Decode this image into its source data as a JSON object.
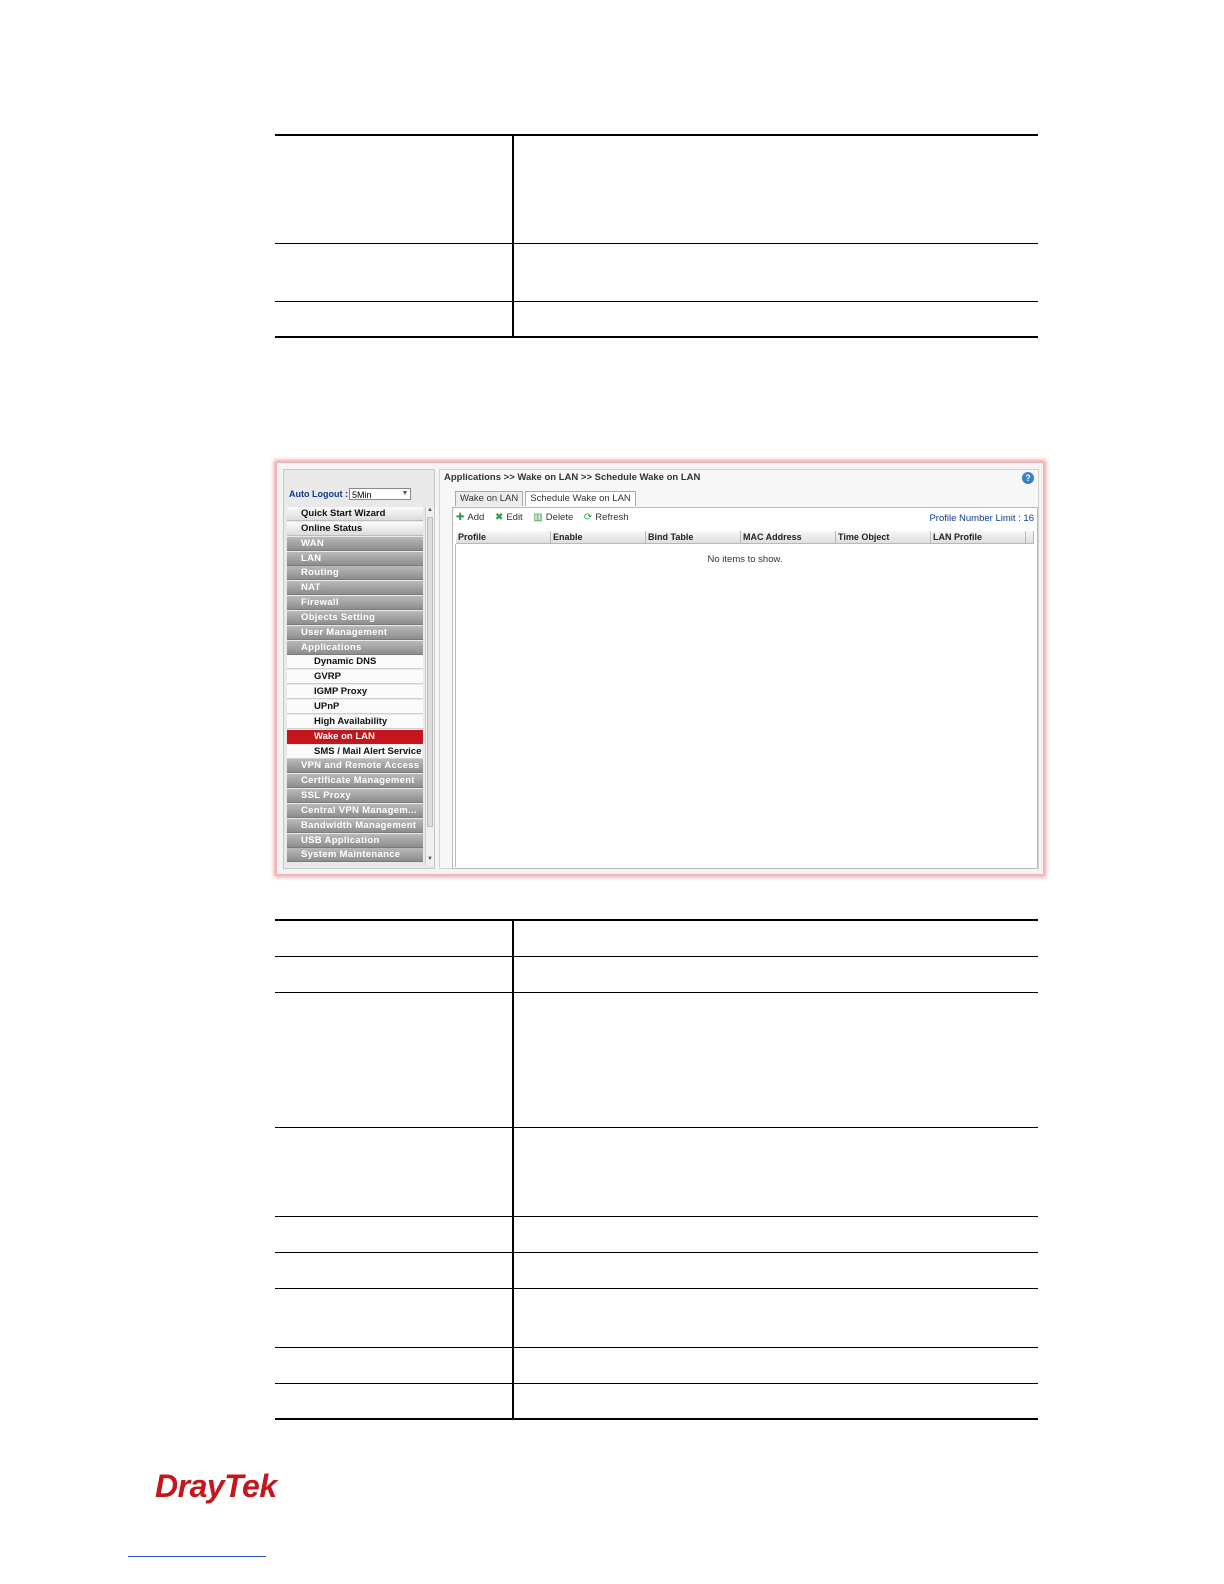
{
  "screenshot": {
    "breadcrumb": "Applications >> Wake on LAN >> Schedule Wake on LAN",
    "auto_logout": {
      "label": "Auto Logout :",
      "value": "5Min"
    },
    "menu": [
      {
        "label": "Quick Start Wizard",
        "style": "light"
      },
      {
        "label": "Online Status",
        "style": "light"
      },
      {
        "label": "WAN",
        "style": "dark"
      },
      {
        "label": "LAN",
        "style": "dark"
      },
      {
        "label": "Routing",
        "style": "dark"
      },
      {
        "label": "NAT",
        "style": "dark"
      },
      {
        "label": "Firewall",
        "style": "dark"
      },
      {
        "label": "Objects Setting",
        "style": "dark"
      },
      {
        "label": "User Management",
        "style": "dark"
      },
      {
        "label": "Applications",
        "style": "dark"
      },
      {
        "label": "Dynamic DNS",
        "style": "sub"
      },
      {
        "label": "GVRP",
        "style": "sub"
      },
      {
        "label": "IGMP Proxy",
        "style": "sub"
      },
      {
        "label": "UPnP",
        "style": "sub"
      },
      {
        "label": "High Availability",
        "style": "sub"
      },
      {
        "label": "Wake on LAN",
        "style": "active"
      },
      {
        "label": "SMS / Mail Alert Service",
        "style": "sub"
      },
      {
        "label": "VPN and Remote Access",
        "style": "dark"
      },
      {
        "label": "Certificate Management",
        "style": "dark"
      },
      {
        "label": "SSL Proxy",
        "style": "dark"
      },
      {
        "label": "Central VPN Managem...",
        "style": "dark"
      },
      {
        "label": "Bandwidth Management",
        "style": "dark"
      },
      {
        "label": "USB Application",
        "style": "dark"
      },
      {
        "label": "System Maintenance",
        "style": "dark"
      }
    ],
    "tabs": [
      "Wake on LAN",
      "Schedule Wake on LAN"
    ],
    "toolbar": {
      "add": "Add",
      "edit": "Edit",
      "delete": "Delete",
      "refresh": "Refresh"
    },
    "limit": "Profile Number Limit : 16",
    "columns": [
      "Profile",
      "Enable",
      "Bind Table",
      "MAC Address",
      "Time Object",
      "LAN Profile"
    ],
    "empty_message": "No items to show."
  },
  "logo": "DrayTek"
}
